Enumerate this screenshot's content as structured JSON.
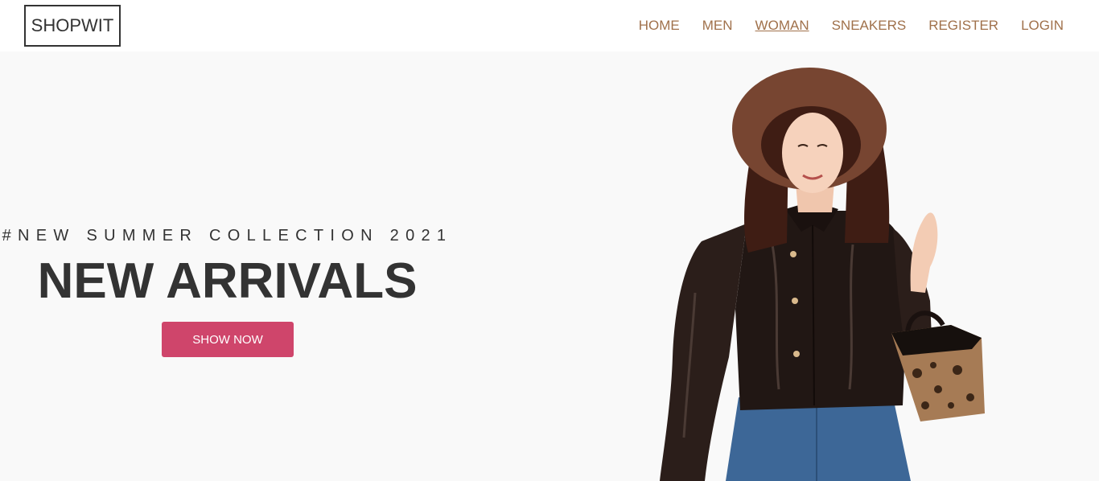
{
  "nav": {
    "logo": "SHOPWIT",
    "items": [
      {
        "label": "HOME",
        "active": false
      },
      {
        "label": "MEN",
        "active": false
      },
      {
        "label": "WOMAN",
        "active": true
      },
      {
        "label": "SNEAKERS",
        "active": false
      },
      {
        "label": "REGISTER",
        "active": false
      },
      {
        "label": "LOGIN",
        "active": false
      }
    ]
  },
  "hero": {
    "subtitle": "#NEW SUMMER COLLECTION 2021",
    "headline": "NEW ARRIVALS",
    "cta_label": "SHOW NOW"
  },
  "colors": {
    "nav_link": "#a0714b",
    "cta_bg": "#cf456b",
    "text_dark": "#333333",
    "hero_bg": "#f9f9f9"
  }
}
